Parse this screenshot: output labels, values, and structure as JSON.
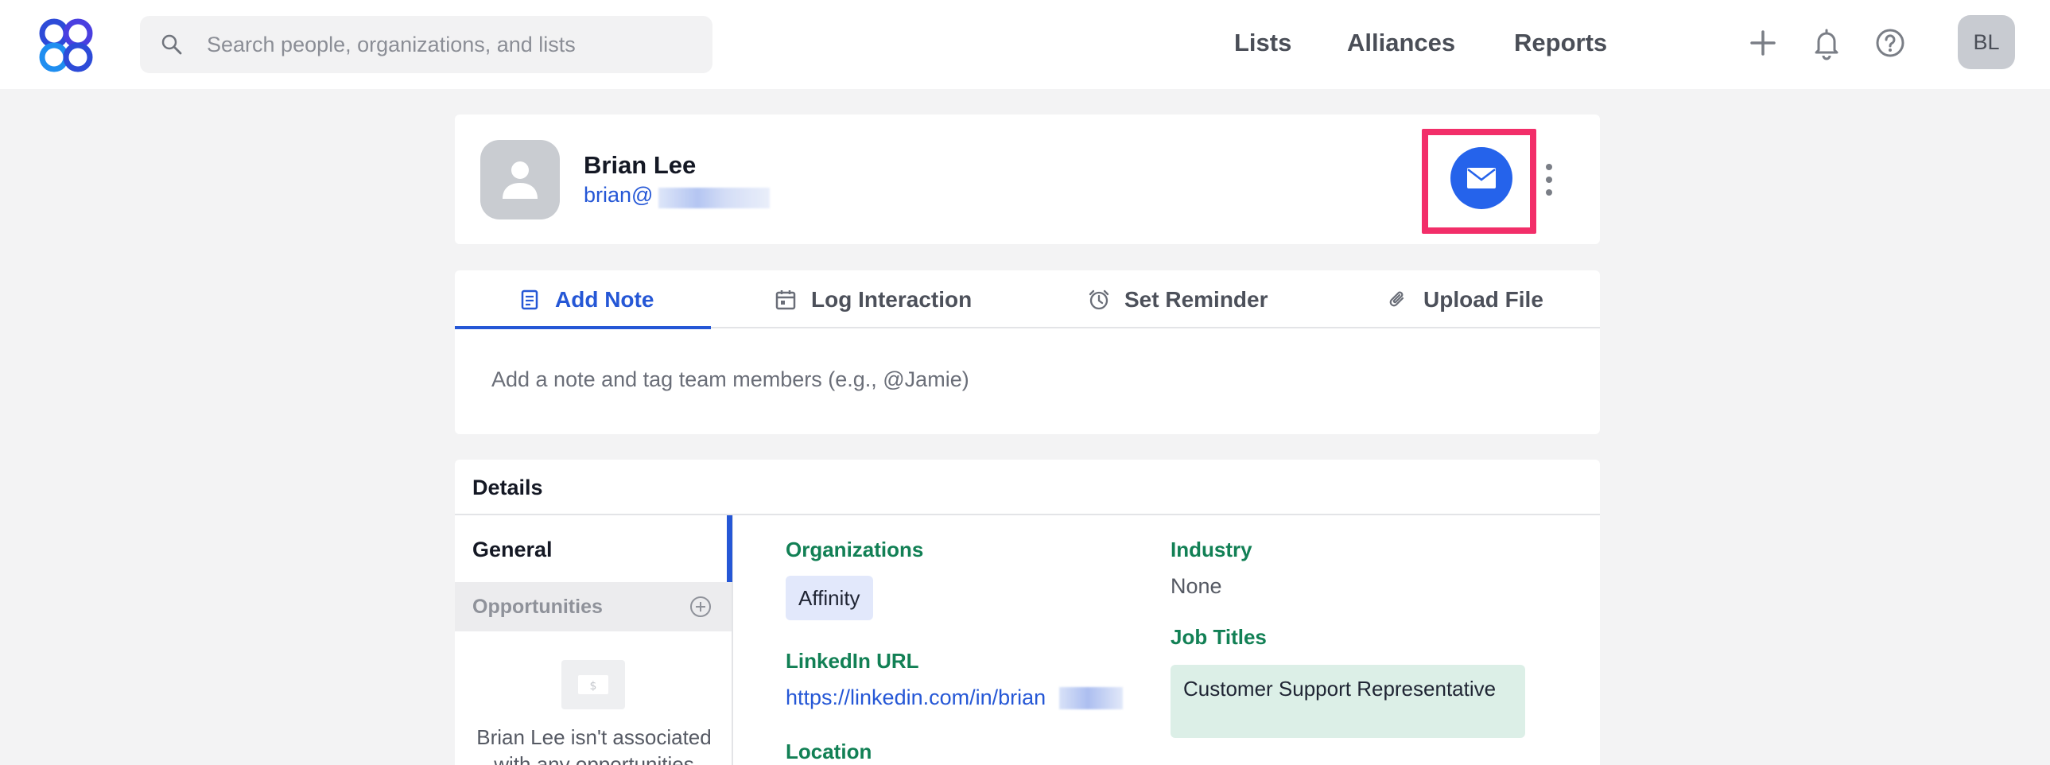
{
  "topbar": {
    "search_placeholder": "Search people, organizations, and lists",
    "nav": {
      "lists": "Lists",
      "alliances": "Alliances",
      "reports": "Reports"
    },
    "user_initials": "BL"
  },
  "profile": {
    "name": "Brian Lee",
    "email_visible": "brian@"
  },
  "composer": {
    "tabs": [
      {
        "label": "Add Note",
        "icon": "note-icon"
      },
      {
        "label": "Log Interaction",
        "icon": "calendar-icon"
      },
      {
        "label": "Set Reminder",
        "icon": "alarm-clock-icon"
      },
      {
        "label": "Upload File",
        "icon": "paperclip-icon"
      }
    ],
    "placeholder": "Add a note and tag team members (e.g., @Jamie)"
  },
  "details": {
    "title": "Details",
    "sidebar": {
      "general": "General",
      "opportunities": "Opportunities",
      "opportunities_empty": "Brian Lee isn't associated with any opportunities"
    },
    "fields": {
      "organizations_label": "Organizations",
      "organizations_value": "Affinity",
      "linkedin_label": "LinkedIn URL",
      "linkedin_value": "https://linkedin.com/in/brian",
      "location_label": "Location",
      "industry_label": "Industry",
      "industry_value": "None",
      "job_titles_label": "Job Titles",
      "job_titles_value": "Customer Support Representative"
    }
  },
  "colors": {
    "accent": "#2557d6",
    "highlight": "#f22e69",
    "field_label": "#128055"
  }
}
